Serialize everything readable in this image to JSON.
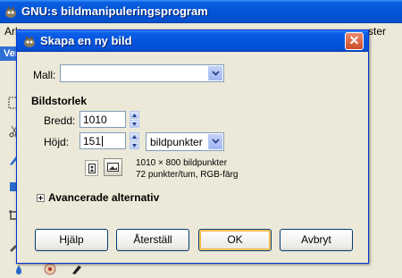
{
  "main_window": {
    "title": "GNU:s bildmanipuleringsprogram",
    "menu_left": "Ark",
    "menu_right": "ster",
    "toolbox_label": "Ver"
  },
  "dialog": {
    "title": "Skapa en ny bild",
    "template": {
      "label": "Mall:",
      "value": ""
    },
    "image_size": {
      "heading": "Bildstorlek",
      "width_label": "Bredd:",
      "width_value": "1010",
      "height_label": "Höjd:",
      "height_value": "151",
      "unit": "bildpunkter",
      "info_dimensions": "1010 × 800 bildpunkter",
      "info_resolution": "72 punkter/tum, RGB-färg"
    },
    "advanced_label": "Avancerade alternativ",
    "buttons": {
      "help": "Hjälp",
      "reset": "Återställ",
      "ok": "OK",
      "cancel": "Avbryt"
    }
  },
  "colors": {
    "titlebar": "#0554df",
    "dialog_bg": "#ece9d8",
    "close": "#cd4b2a"
  }
}
